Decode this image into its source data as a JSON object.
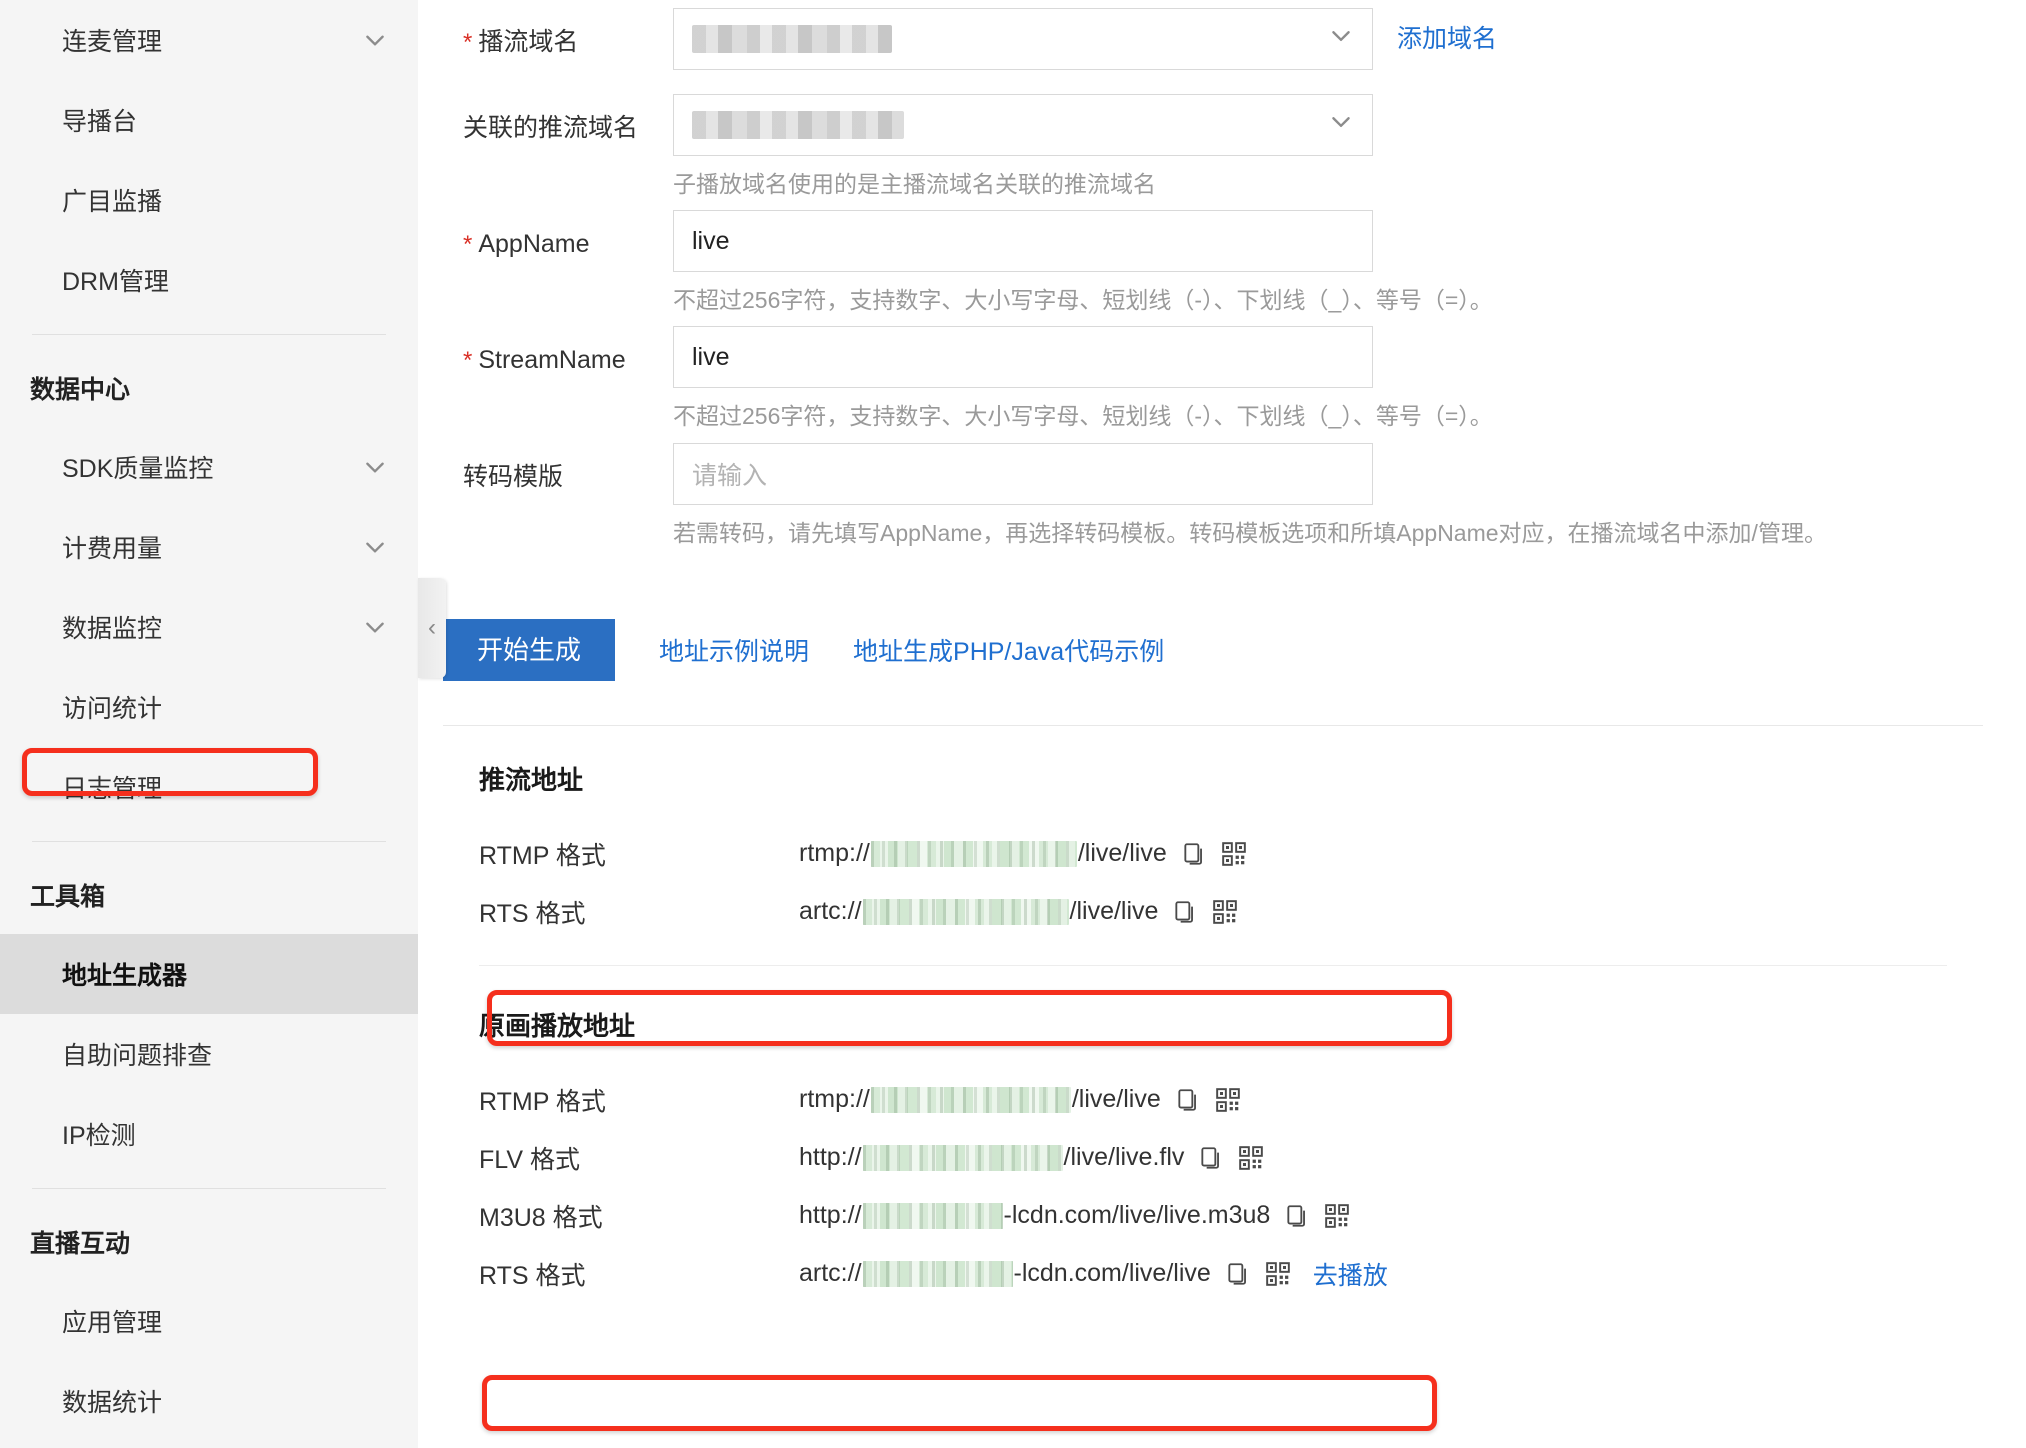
{
  "sidebar": {
    "items": [
      {
        "label": "连麦管理",
        "type": "item",
        "expandable": true,
        "selected": false
      },
      {
        "label": "导播台",
        "type": "item",
        "expandable": false,
        "selected": false
      },
      {
        "label": "广目监播",
        "type": "item",
        "expandable": false,
        "selected": false
      },
      {
        "label": "DRM管理",
        "type": "item",
        "expandable": false,
        "selected": false
      },
      {
        "label": "",
        "type": "separator"
      },
      {
        "label": "数据中心",
        "type": "group"
      },
      {
        "label": "SDK质量监控",
        "type": "item",
        "expandable": true,
        "selected": false
      },
      {
        "label": "计费用量",
        "type": "item",
        "expandable": true,
        "selected": false
      },
      {
        "label": "数据监控",
        "type": "item",
        "expandable": true,
        "selected": false
      },
      {
        "label": "访问统计",
        "type": "item",
        "expandable": false,
        "selected": false
      },
      {
        "label": "日志管理",
        "type": "item",
        "expandable": false,
        "selected": false
      },
      {
        "label": "",
        "type": "separator"
      },
      {
        "label": "工具箱",
        "type": "group"
      },
      {
        "label": "地址生成器",
        "type": "item",
        "expandable": false,
        "selected": true
      },
      {
        "label": "自助问题排查",
        "type": "item",
        "expandable": false,
        "selected": false
      },
      {
        "label": "IP检测",
        "type": "item",
        "expandable": false,
        "selected": false
      },
      {
        "label": "",
        "type": "separator"
      },
      {
        "label": "直播互动",
        "type": "group"
      },
      {
        "label": "应用管理",
        "type": "item",
        "expandable": false,
        "selected": false
      },
      {
        "label": "数据统计",
        "type": "item",
        "expandable": false,
        "selected": false
      }
    ],
    "collapse_handle_icon": "chevron-left-icon"
  },
  "form": {
    "fields": [
      {
        "label": "播流域名",
        "required": true,
        "kind": "select",
        "value": "",
        "redacted": true,
        "redact_width": 200,
        "helper": "",
        "side_link": "添加域名"
      },
      {
        "label": "关联的推流域名",
        "required": false,
        "kind": "select",
        "value": "",
        "redacted": true,
        "redact_width": 212,
        "helper": "子播放域名使用的是主播流域名关联的推流域名",
        "side_link": ""
      },
      {
        "label": "AppName",
        "required": true,
        "kind": "text",
        "value": "live",
        "redacted": false,
        "helper": "不超过256字符，支持数字、大小写字母、短划线（-）、下划线（_）、等号（=）。",
        "side_link": ""
      },
      {
        "label": "StreamName",
        "required": true,
        "kind": "text",
        "value": "live",
        "redacted": false,
        "helper": "不超过256字符，支持数字、大小写字母、短划线（-）、下划线（_）、等号（=）。",
        "side_link": ""
      },
      {
        "label": "转码模版",
        "required": false,
        "kind": "text",
        "value": "",
        "placeholder": "请输入",
        "redacted": false,
        "helper": "若需转码，请先填写AppName，再选择转码模板。转码模板选项和所填AppName对应，在播流域名中添加/管理。",
        "side_link": ""
      }
    ]
  },
  "actions": {
    "generate_button": "开始生成",
    "links": [
      "地址示例说明",
      "地址生成PHP/Java代码示例"
    ]
  },
  "results": {
    "push": {
      "title": "推流地址",
      "rows": [
        {
          "kind": "RTMP 格式",
          "prefix": "rtmp://",
          "redact_width": 206,
          "suffix": "/live/live",
          "icons": [
            "copy-icon",
            "qrcode-icon"
          ],
          "play_link": "",
          "highlighted": false
        },
        {
          "kind": "RTS 格式",
          "prefix": "artc://",
          "redact_width": 206,
          "suffix": "/live/live",
          "icons": [
            "copy-icon",
            "qrcode-icon"
          ],
          "play_link": "",
          "highlighted": true
        }
      ]
    },
    "play": {
      "title": "原画播放地址",
      "rows": [
        {
          "kind": "RTMP 格式",
          "prefix": "rtmp://",
          "redact_width": 200,
          "suffix": "/live/live",
          "icons": [
            "copy-icon",
            "qrcode-icon"
          ],
          "play_link": "",
          "highlighted": false
        },
        {
          "kind": "FLV 格式",
          "prefix": "http://",
          "redact_width": 200,
          "suffix": "/live/live.flv",
          "icons": [
            "copy-icon",
            "qrcode-icon"
          ],
          "play_link": "",
          "highlighted": false
        },
        {
          "kind": "M3U8 格式",
          "prefix": "http://",
          "redact_width": 140,
          "suffix": "-lcdn.com/live/live.m3u8",
          "icons": [
            "copy-icon",
            "qrcode-icon"
          ],
          "play_link": "",
          "highlighted": false
        },
        {
          "kind": "RTS 格式",
          "prefix": "artc://",
          "redact_width": 150,
          "suffix": "-lcdn.com/live/live",
          "icons": [
            "copy-icon",
            "qrcode-icon"
          ],
          "play_link": "去播放",
          "highlighted": true
        }
      ]
    }
  },
  "colors": {
    "accent_blue": "#2b6fc2",
    "link_blue": "#1f6fd0",
    "annotation_red": "#f52f1d",
    "sidebar_bg": "#f5f5f5",
    "selected_bg": "#dcdcdc"
  }
}
